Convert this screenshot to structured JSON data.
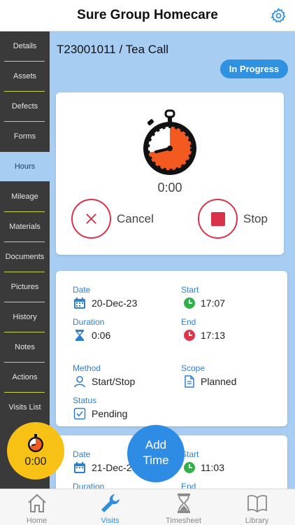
{
  "header": {
    "title": "Sure Group Homecare"
  },
  "sidebar": {
    "items": [
      {
        "label": "Details"
      },
      {
        "label": "Assets"
      },
      {
        "label": "Defects"
      },
      {
        "label": "Forms"
      },
      {
        "label": "Hours"
      },
      {
        "label": "Mileage"
      },
      {
        "label": "Materials"
      },
      {
        "label": "Documents"
      },
      {
        "label": "Pictures"
      },
      {
        "label": "History"
      },
      {
        "label": "Notes"
      },
      {
        "label": "Actions"
      },
      {
        "label": "Visits List"
      }
    ],
    "active": "Hours"
  },
  "visit": {
    "title": "T23001011 / Tea Call",
    "status": "In Progress"
  },
  "timer": {
    "value": "0:00",
    "cancel_label": "Cancel",
    "stop_label": "Stop"
  },
  "entry1": {
    "date_label": "Date",
    "date": "20-Dec-23",
    "start_label": "Start",
    "start": "17:07",
    "duration_label": "Duration",
    "duration": "0:06",
    "end_label": "End",
    "end": "17:13",
    "method_label": "Method",
    "method": "Start/Stop",
    "scope_label": "Scope",
    "scope": "Planned",
    "status_label": "Status",
    "status": "Pending"
  },
  "entry2": {
    "date_label": "Date",
    "date": "21-Dec-23",
    "start_label": "Start",
    "start": "11:03",
    "duration_label": "Duration",
    "end_label": "End"
  },
  "timer_fab": {
    "time": "0:00"
  },
  "add_fab": {
    "line1": "Add",
    "line2": "Time"
  },
  "tabs": [
    {
      "label": "Home",
      "icon": "home-icon"
    },
    {
      "label": "Visits",
      "icon": "wrench-icon"
    },
    {
      "label": "Timesheet",
      "icon": "hourglass-icon"
    },
    {
      "label": "Library",
      "icon": "book-icon"
    }
  ],
  "colors": {
    "accent_blue": "#2e92e0",
    "panel_blue": "#a8cdf2",
    "sidebar_dark": "#3a3a3a",
    "stop_red": "#d9334c",
    "fab_yellow": "#f8c116",
    "stopwatch_orange": "#f25a1f"
  }
}
